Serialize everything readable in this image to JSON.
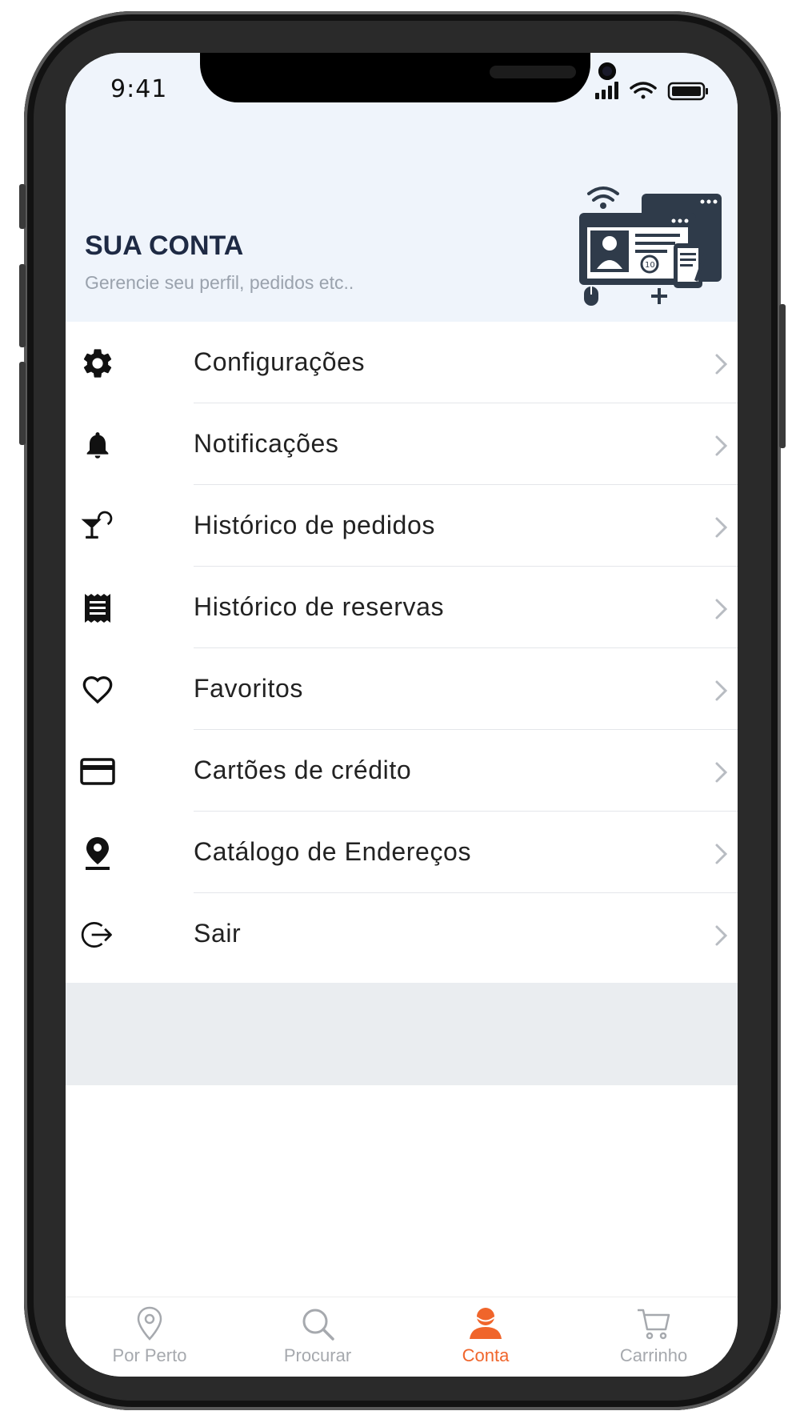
{
  "status_bar": {
    "time": "9:41"
  },
  "header": {
    "title": "SUA CONTA",
    "subtitle": "Gerencie seu perfil, pedidos etc.."
  },
  "menu": {
    "items": [
      {
        "label": "Configurações",
        "icon": "gear-icon"
      },
      {
        "label": "Notificações",
        "icon": "bell-icon"
      },
      {
        "label": "Histórico de pedidos",
        "icon": "cocktail-icon"
      },
      {
        "label": "Histórico de reservas",
        "icon": "receipt-icon"
      },
      {
        "label": "Favoritos",
        "icon": "heart-icon"
      },
      {
        "label": "Cartões de crédito",
        "icon": "credit-card-icon"
      },
      {
        "label": "Catálogo de Endereços",
        "icon": "location-pin-icon"
      },
      {
        "label": "Sair",
        "icon": "logout-icon"
      }
    ]
  },
  "tabbar": {
    "tabs": [
      {
        "label": "Por Perto",
        "icon": "map-pin-icon",
        "active": false
      },
      {
        "label": "Procurar",
        "icon": "search-icon",
        "active": false
      },
      {
        "label": "Conta",
        "icon": "user-icon",
        "active": true
      },
      {
        "label": "Carrinho",
        "icon": "cart-icon",
        "active": false
      }
    ]
  },
  "colors": {
    "accent": "#f0652b",
    "header_bg": "#eff4fb",
    "title": "#1e2a44",
    "inactive_tab": "#a6a9ae"
  }
}
